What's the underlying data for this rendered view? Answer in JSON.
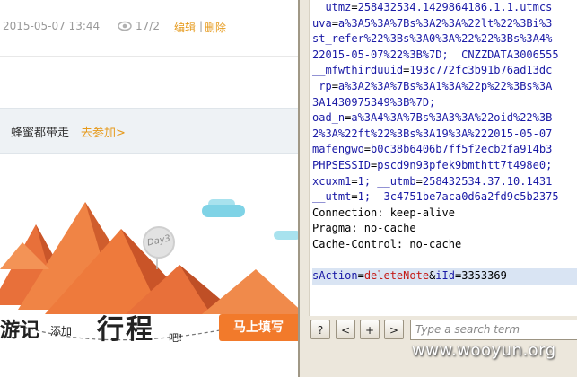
{
  "post_meta": {
    "datetime": "2015-05-07 13:44",
    "views": "17/2",
    "edit_label": "编辑",
    "separator": "|",
    "delete_label": "删除"
  },
  "invite": {
    "text": "蜂蜜都带走",
    "link": "去参加>"
  },
  "banner": {
    "day_badge": "Day3",
    "slogan_1": "游记",
    "slogan_2": "添加",
    "slogan_3": "行程",
    "slogan_4": "吧!",
    "cta": "马上填写"
  },
  "request_lines": [
    {
      "k": "__utmz",
      "v": "258432534.1429864186.1.1.utmcs",
      "kind": "cookie"
    },
    {
      "k": "uva",
      "v": "a%3A5%3A%7Bs%3A2%3A%22lt%22%3Bi%3",
      "kind": "cookie"
    },
    {
      "k": "",
      "v": "st_refer%22%3Bs%3A0%3A%22%22%3Bs%3A4%",
      "kind": "cont"
    },
    {
      "k": "",
      "v": "22015-05-07%22%3B%7D;",
      "kind": "cont",
      "tail": "CNZZDATA3006555"
    },
    {
      "k": "__mfwthirduuid",
      "v": "193c772fc3b91b76ad13dc",
      "kind": "cookie"
    },
    {
      "k": "_rp",
      "v": "a%3A2%3A%7Bs%3A1%3A%22p%22%3Bs%3A",
      "kind": "cookie"
    },
    {
      "k": "",
      "v": "3A1430975349%3B%7D;",
      "kind": "cont"
    },
    {
      "k": "oad_n",
      "v": "a%3A4%3A%7Bs%3A3%3A%22oid%22%3B",
      "kind": "cookie"
    },
    {
      "k": "",
      "v": "2%3A%22ft%22%3Bs%3A19%3A%222015-05-07",
      "kind": "cont"
    },
    {
      "k": "mafengwo",
      "v": "b0c38b6406b7ff5f2ecb2fa914b3",
      "kind": "cookie"
    },
    {
      "k": "PHPSESSID",
      "v": "pscd9n93pfek9bmthtt7t498e0;",
      "kind": "cookie"
    },
    {
      "k": "xcuxm1",
      "v": "1;",
      "kind": "cookie",
      "tail2k": "__utmb",
      "tail2v": "258432534.37.10.1431"
    },
    {
      "k": "__utmt",
      "v": "1;",
      "kind": "cookie",
      "tail": "3c4751be7aca0d6a2fd9c5b2375"
    },
    {
      "plain": "Connection: keep-alive"
    },
    {
      "plain": "Pragma: no-cache"
    },
    {
      "plain": "Cache-Control: no-cache"
    },
    {
      "plain": ""
    },
    {
      "body_key1": "sAction",
      "body_val1": "deleteNote",
      "body_key2": "iId",
      "body_val2": "3353369"
    }
  ],
  "toolbar": {
    "help": "?",
    "prev": "<",
    "add": "+",
    "next": ">",
    "search_placeholder": "Type a search term"
  },
  "watermark": "www.wooyun.org",
  "colors": {
    "accent_orange": "#e69a1c",
    "cta_orange": "#f27a2b",
    "param_blue": "#1a1aa6",
    "value_red": "#c41a16"
  }
}
